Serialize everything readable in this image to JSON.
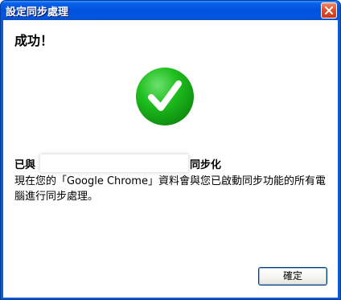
{
  "window": {
    "title": "設定同步處理"
  },
  "dialog": {
    "heading": "成功！",
    "sync_prefix": "已與",
    "sync_suffix": "同步化",
    "description": "現在您的「Google Chrome」資料會與您已啟動同步功能的所有電腦進行同步處理。",
    "ok_label": "確定"
  },
  "icons": {
    "close": "close-icon",
    "success": "checkmark-icon"
  },
  "colors": {
    "titlebar": "#0051de",
    "success_green": "#1db71d",
    "close_red": "#e0502e"
  }
}
